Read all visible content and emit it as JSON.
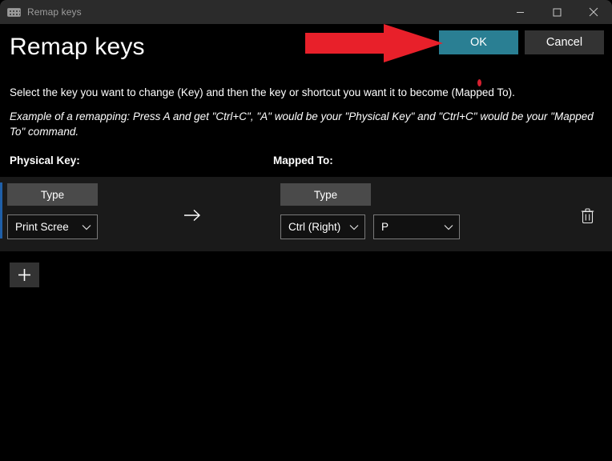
{
  "window": {
    "titlebar_title": "Remap keys",
    "titlebar_icon": "keyboard-icon",
    "minimize_label": "Minimize",
    "maximize_label": "Maximize",
    "close_label": "Close"
  },
  "header": {
    "page_title": "Remap keys",
    "ok_label": "OK",
    "cancel_label": "Cancel"
  },
  "instructions": {
    "description": "Select the key you want to change (Key) and then the key or shortcut you want it to become (Mapped To).",
    "example": "Example of a remapping: Press A and get \"Ctrl+C\", \"A\" would be your \"Physical Key\" and \"Ctrl+C\" would be your \"Mapped To\" command."
  },
  "columns": {
    "physical_key_label": "Physical Key:",
    "mapped_to_label": "Mapped To:"
  },
  "row": {
    "physical": {
      "type_label": "Type",
      "key_value": "Print Scree"
    },
    "separator_icon": "arrow-right-icon",
    "mapped": {
      "type_label": "Type",
      "modifier_value": "Ctrl (Right)",
      "key_value": "P"
    },
    "delete_icon": "trash-icon",
    "delete_label": "Delete remapping"
  },
  "footer": {
    "add_icon": "plus-icon",
    "add_label": "Add remapping"
  },
  "annotation": {
    "arrow_icon": "red-arrow-right-icon",
    "arrow_color": "#E8202A",
    "points_to": "OK"
  },
  "colors": {
    "page_background": "#000000",
    "titlebar_background": "#2B2B2B",
    "row_band_background": "#1A1A1A",
    "ok_accent": "#2A7F93",
    "cancel_background": "#333333",
    "type_button_background": "#4A4A4A",
    "focus_indicator": "#1F5FA8",
    "annotation_red": "#E8202A"
  }
}
